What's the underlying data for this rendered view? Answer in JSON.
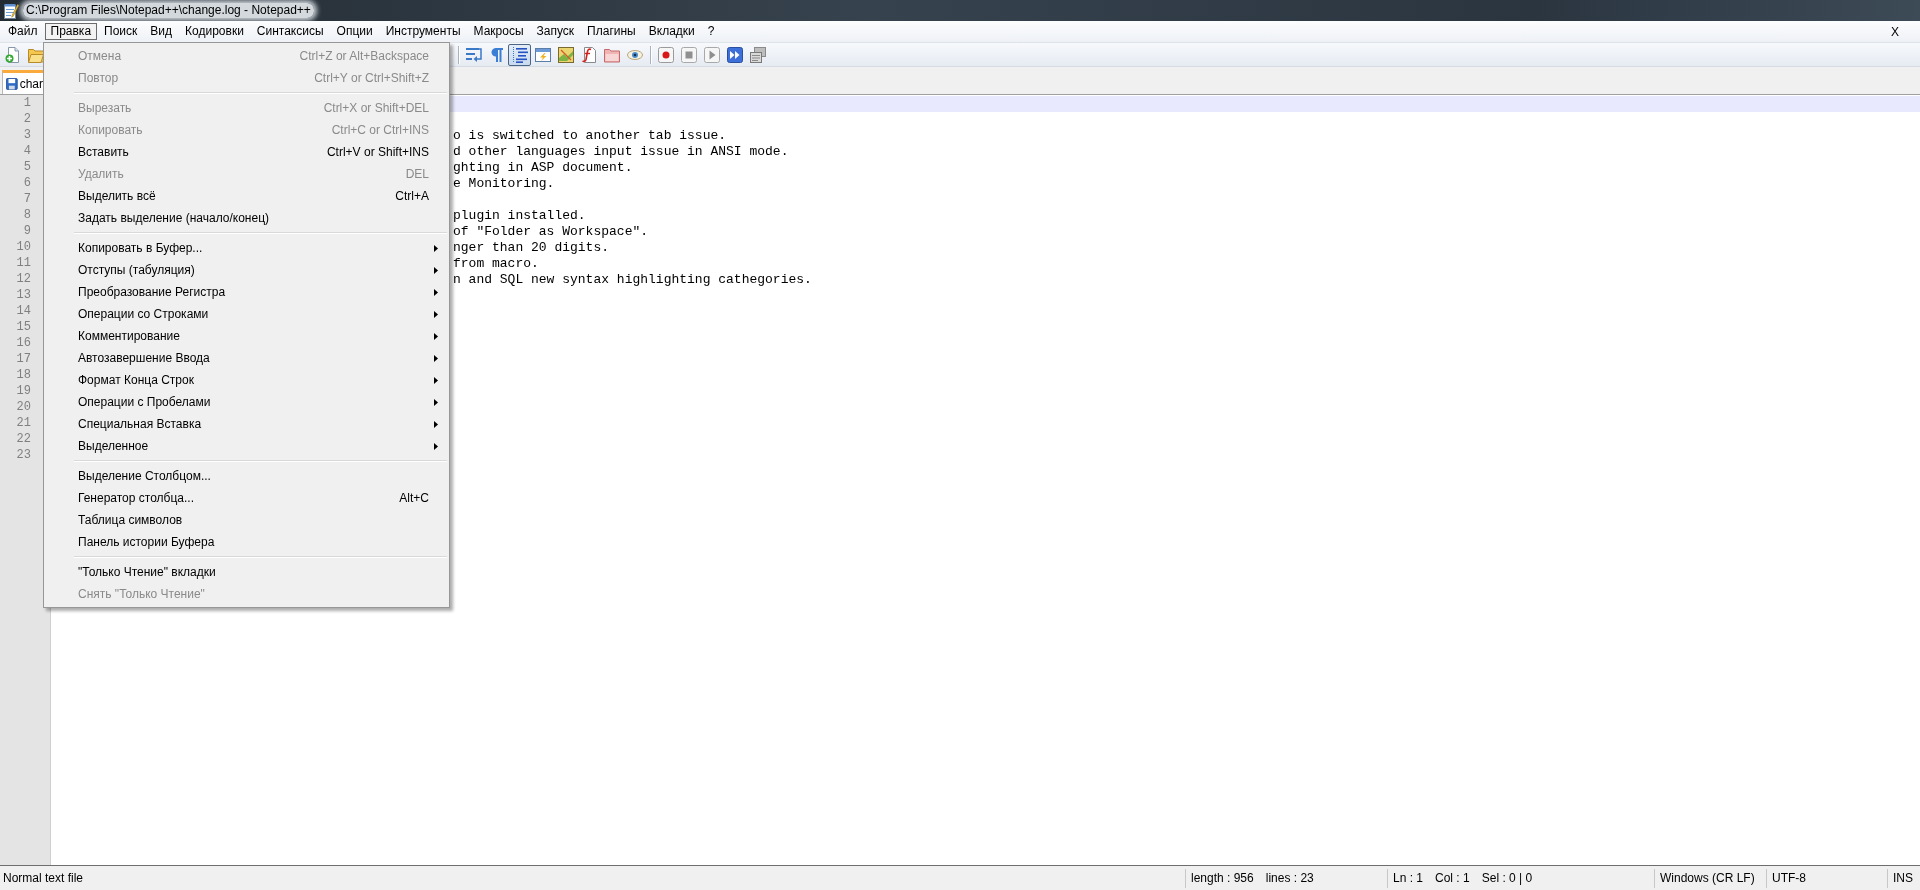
{
  "window": {
    "title": "C:\\Program Files\\Notepad++\\change.log - Notepad++"
  },
  "menu_bar": {
    "items": [
      {
        "label": "Файл",
        "selected": false
      },
      {
        "label": "Правка",
        "selected": true
      },
      {
        "label": "Поиск",
        "selected": false
      },
      {
        "label": "Вид",
        "selected": false
      },
      {
        "label": "Кодировки",
        "selected": false
      },
      {
        "label": "Синтаксисы",
        "selected": false
      },
      {
        "label": "Опции",
        "selected": false
      },
      {
        "label": "Инструменты",
        "selected": false
      },
      {
        "label": "Макросы",
        "selected": false
      },
      {
        "label": "Запуск",
        "selected": false
      },
      {
        "label": "Плагины",
        "selected": false
      },
      {
        "label": "Вкладки",
        "selected": false
      },
      {
        "label": "?",
        "selected": false
      }
    ],
    "close": "X"
  },
  "edit_menu": {
    "groups": [
      {
        "items": [
          {
            "label": "Отмена",
            "shortcut": "Ctrl+Z or Alt+Backspace",
            "disabled": true,
            "submenu": false
          },
          {
            "label": "Повтор",
            "shortcut": "Ctrl+Y or Ctrl+Shift+Z",
            "disabled": true,
            "submenu": false
          }
        ]
      },
      {
        "items": [
          {
            "label": "Вырезать",
            "shortcut": "Ctrl+X or Shift+DEL",
            "disabled": true,
            "submenu": false
          },
          {
            "label": "Копировать",
            "shortcut": "Ctrl+C or Ctrl+INS",
            "disabled": true,
            "submenu": false
          },
          {
            "label": "Вставить",
            "shortcut": "Ctrl+V or Shift+INS",
            "disabled": false,
            "submenu": false
          },
          {
            "label": "Удалить",
            "shortcut": "DEL",
            "disabled": true,
            "submenu": false
          },
          {
            "label": "Выделить всё",
            "shortcut": "Ctrl+A",
            "disabled": false,
            "submenu": false
          },
          {
            "label": "Задать выделение (начало/конец)",
            "disabled": false,
            "submenu": false
          }
        ]
      },
      {
        "items": [
          {
            "label": "Копировать в Буфер...",
            "disabled": false,
            "submenu": true
          },
          {
            "label": "Отступы (табуляция)",
            "disabled": false,
            "submenu": true
          },
          {
            "label": "Преобразование Регистра",
            "disabled": false,
            "submenu": true
          },
          {
            "label": "Операции со Строками",
            "disabled": false,
            "submenu": true
          },
          {
            "label": "Комментирование",
            "disabled": false,
            "submenu": true
          },
          {
            "label": "Автозавершение Ввода",
            "disabled": false,
            "submenu": true
          },
          {
            "label": "Формат Конца Строк",
            "disabled": false,
            "submenu": true
          },
          {
            "label": "Операции с Пробелами",
            "disabled": false,
            "submenu": true
          },
          {
            "label": "Специальная Вставка",
            "disabled": false,
            "submenu": true
          },
          {
            "label": "Выделенное",
            "disabled": false,
            "submenu": true
          }
        ]
      },
      {
        "items": [
          {
            "label": "Выделение Столбцом...",
            "disabled": false,
            "submenu": false
          },
          {
            "label": "Генератор столбца...",
            "shortcut": "Alt+C",
            "disabled": false,
            "submenu": false
          },
          {
            "label": "Таблица символов",
            "disabled": false,
            "submenu": false
          },
          {
            "label": "Панель истории Буфера",
            "disabled": false,
            "submenu": false
          }
        ]
      },
      {
        "items": [
          {
            "label": "\"Только Чтение\" вкладки",
            "disabled": false,
            "submenu": false
          },
          {
            "label": "Снять \"Только Чтение\"",
            "disabled": true,
            "submenu": false
          }
        ]
      }
    ]
  },
  "toolbar": {
    "left": [
      {
        "kind": "new",
        "pressed": false
      },
      {
        "kind": "open",
        "pressed": false
      }
    ],
    "right": [
      {
        "kind": "separator"
      },
      {
        "kind": "wrap",
        "pressed": false
      },
      {
        "kind": "pilcrow",
        "pressed": false
      },
      {
        "kind": "indent",
        "pressed": true
      },
      {
        "kind": "window",
        "pressed": false
      },
      {
        "kind": "map",
        "pressed": false
      },
      {
        "kind": "function",
        "pressed": false
      },
      {
        "kind": "folder",
        "pressed": false
      },
      {
        "kind": "eye",
        "pressed": false
      },
      {
        "kind": "separator"
      },
      {
        "kind": "record",
        "pressed": false
      },
      {
        "kind": "stop",
        "pressed": false
      },
      {
        "kind": "play",
        "pressed": false
      },
      {
        "kind": "forward",
        "pressed": false
      },
      {
        "kind": "save",
        "pressed": false
      }
    ]
  },
  "tabs": [
    {
      "label": "char",
      "selected": true
    }
  ],
  "editor": {
    "lines": [
      {
        "number": "1",
        "current": true
      },
      {
        "number": "2",
        "current": false
      },
      {
        "number": "3",
        "text": "o is switched to another tab issue.",
        "current": false
      },
      {
        "number": "4",
        "text": "d other languages input issue in ANSI mode.",
        "current": false
      },
      {
        "number": "5",
        "text": "ghting in ASP document.",
        "current": false
      },
      {
        "number": "6",
        "text": "e Monitoring.",
        "current": false
      },
      {
        "number": "7",
        "current": false
      },
      {
        "number": "8",
        "text": "plugin installed.",
        "current": false
      },
      {
        "number": "9",
        "text": "of \"Folder as Workspace\".",
        "current": false
      },
      {
        "number": "10",
        "text": "nger than 20 digits.",
        "current": false
      },
      {
        "number": "11",
        "text": "from macro.",
        "current": false
      },
      {
        "number": "12",
        "text": "n and SQL new syntax highlighting cathegories.",
        "current": false
      },
      {
        "number": "13",
        "current": false
      },
      {
        "number": "14",
        "current": false
      },
      {
        "number": "15",
        "current": false
      },
      {
        "number": "16",
        "current": false
      },
      {
        "number": "17",
        "current": false
      },
      {
        "number": "18",
        "current": false
      },
      {
        "number": "19",
        "current": false
      },
      {
        "number": "20",
        "current": false
      },
      {
        "number": "21",
        "current": false
      },
      {
        "number": "22",
        "current": false
      },
      {
        "number": "23",
        "current": false
      }
    ]
  },
  "status_bar": {
    "panels": [
      {
        "items": [
          "Normal text file"
        ]
      },
      {
        "items": [
          "length : 956",
          "lines : 23"
        ]
      },
      {
        "items": [
          "Ln : 1",
          "Col : 1",
          "Sel : 0 | 0"
        ]
      },
      {
        "items": [
          "Windows (CR LF)"
        ]
      },
      {
        "items": [
          "UTF-8"
        ]
      },
      {
        "items": [
          "INS"
        ]
      }
    ]
  }
}
